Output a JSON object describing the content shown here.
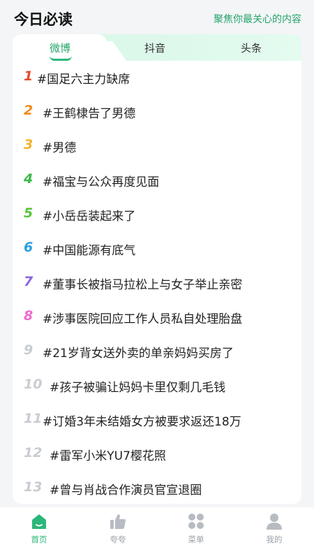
{
  "header": {
    "title": "今日必读",
    "subtitle": "聚焦你最关心的内容"
  },
  "tabs": [
    {
      "label": "微博",
      "active": true
    },
    {
      "label": "抖音",
      "active": false
    },
    {
      "label": "头条",
      "active": false
    }
  ],
  "list": [
    {
      "rank": "1",
      "text": "#国足六主力缺席",
      "color": "#e24a2c"
    },
    {
      "rank": "2",
      "text": "#王鹤棣告了男德",
      "color": "#f28a1e"
    },
    {
      "rank": "3",
      "text": "#男德",
      "color": "#f3b22b"
    },
    {
      "rank": "4",
      "text": "#福宝与公众再度见面",
      "color": "#3cb84a"
    },
    {
      "rank": "5",
      "text": "#小岳岳装起来了",
      "color": "#57c53c"
    },
    {
      "rank": "6",
      "text": "#中国能源有底气",
      "color": "#2a9fe3"
    },
    {
      "rank": "7",
      "text": "#董事长被指马拉松上与女子举止亲密",
      "color": "#8e64e0"
    },
    {
      "rank": "8",
      "text": "#涉事医院回应工作人员私自处理胎盘",
      "color": "#ef6ad0"
    },
    {
      "rank": "9",
      "text": "#21岁背女送外卖的单亲妈妈买房了",
      "color": "#c8ccd2"
    },
    {
      "rank": "10",
      "text": "#孩子被骗让妈妈卡里仅剩几毛钱",
      "color": "#c8ccd2"
    },
    {
      "rank": "11",
      "text": "#订婚3年未结婚女方被要求返还18万",
      "color": "#c8ccd2"
    },
    {
      "rank": "12",
      "text": "#雷军小米YU7樱花照",
      "color": "#c8ccd2"
    },
    {
      "rank": "13",
      "text": "#曾与肖战合作演员官宣退圈",
      "color": "#c8ccd2"
    }
  ],
  "bottom_nav": [
    {
      "label": "首页",
      "icon": "home-icon",
      "active": true
    },
    {
      "label": "夸夸",
      "icon": "thumbs-up-icon",
      "active": false
    },
    {
      "label": "菜单",
      "icon": "grid-menu-icon",
      "active": false
    },
    {
      "label": "我的",
      "icon": "user-icon",
      "active": false
    }
  ],
  "colors": {
    "accent": "#2bb77a",
    "inactive": "#b7bcc2"
  }
}
